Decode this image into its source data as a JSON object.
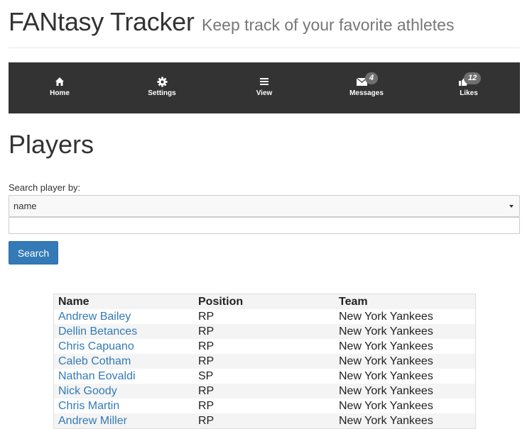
{
  "header": {
    "title": "FANtasy Tracker",
    "subtitle": "Keep track of your favorite athletes"
  },
  "nav": {
    "items": [
      {
        "label": "Home",
        "icon": "home-icon"
      },
      {
        "label": "Settings",
        "icon": "gear-icon"
      },
      {
        "label": "View",
        "icon": "list-icon"
      },
      {
        "label": "Messages",
        "icon": "envelope-icon",
        "badge": "4"
      },
      {
        "label": "Likes",
        "icon": "thumbs-up-icon",
        "badge": "12"
      }
    ],
    "background": "#333333",
    "badge_color": "#6f6f6f"
  },
  "main": {
    "title": "Players",
    "search_label": "Search player by:",
    "search_by_selected": "name",
    "search_text_value": "",
    "search_button_label": "Search"
  },
  "table": {
    "columns": [
      "Name",
      "Position",
      "Team"
    ],
    "rows": [
      {
        "name": "Andrew Bailey",
        "position": "RP",
        "team": "New York Yankees"
      },
      {
        "name": "Dellin Betances",
        "position": "RP",
        "team": "New York Yankees"
      },
      {
        "name": "Chris Capuano",
        "position": "RP",
        "team": "New York Yankees"
      },
      {
        "name": "Caleb Cotham",
        "position": "RP",
        "team": "New York Yankees"
      },
      {
        "name": "Nathan Eovaldi",
        "position": "SP",
        "team": "New York Yankees"
      },
      {
        "name": "Nick Goody",
        "position": "RP",
        "team": "New York Yankees"
      },
      {
        "name": "Chris Martin",
        "position": "RP",
        "team": "New York Yankees"
      },
      {
        "name": "Andrew Miller",
        "position": "RP",
        "team": "New York Yankees"
      }
    ],
    "link_color": "#337ab7"
  }
}
